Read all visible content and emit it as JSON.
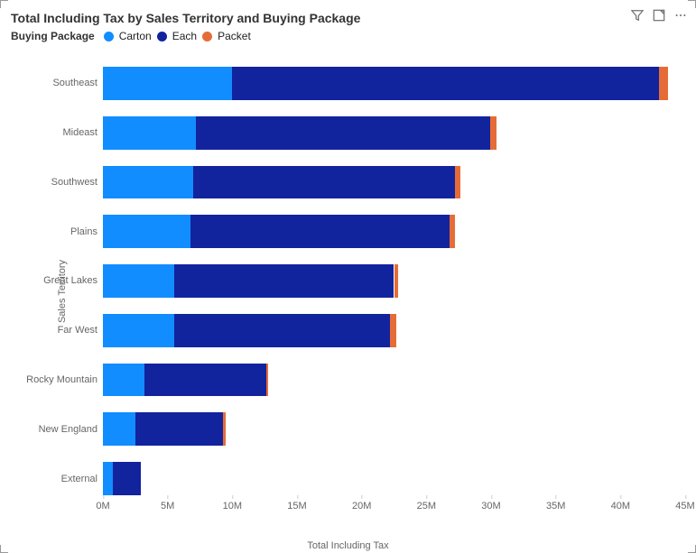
{
  "title": "Total Including Tax by Sales Territory and Buying Package",
  "legend_title": "Buying Package",
  "legend_items": [
    {
      "label": "Carton",
      "color": "#118DFF"
    },
    {
      "label": "Each",
      "color": "#12239E"
    },
    {
      "label": "Packet",
      "color": "#E66C37"
    }
  ],
  "yaxis_title": "Sales Territory",
  "xaxis_title": "Total Including Tax",
  "chart_data": {
    "type": "bar",
    "orientation": "horizontal",
    "stacked": true,
    "xlabel": "Total Including Tax",
    "ylabel": "Sales Territory",
    "xlim": [
      0,
      45000000
    ],
    "x_ticks": [
      0,
      5000000,
      10000000,
      15000000,
      20000000,
      25000000,
      30000000,
      35000000,
      40000000,
      45000000
    ],
    "x_tick_labels": [
      "0M",
      "5M",
      "10M",
      "15M",
      "20M",
      "25M",
      "30M",
      "35M",
      "40M",
      "45M"
    ],
    "categories": [
      "Southeast",
      "Mideast",
      "Southwest",
      "Plains",
      "Great Lakes",
      "Far West",
      "Rocky Mountain",
      "New England",
      "External"
    ],
    "series": [
      {
        "name": "Carton",
        "color": "#118DFF",
        "values": [
          10000000,
          7200000,
          7000000,
          6800000,
          5500000,
          5500000,
          3200000,
          2500000,
          800000
        ]
      },
      {
        "name": "Each",
        "color": "#12239E",
        "values": [
          33000000,
          22700000,
          20200000,
          20000000,
          17000000,
          16700000,
          9400000,
          6800000,
          2100000
        ]
      },
      {
        "name": "Packet",
        "color": "#E66C37",
        "values": [
          700000,
          500000,
          400000,
          400000,
          300000,
          500000,
          200000,
          200000,
          0
        ]
      }
    ]
  }
}
